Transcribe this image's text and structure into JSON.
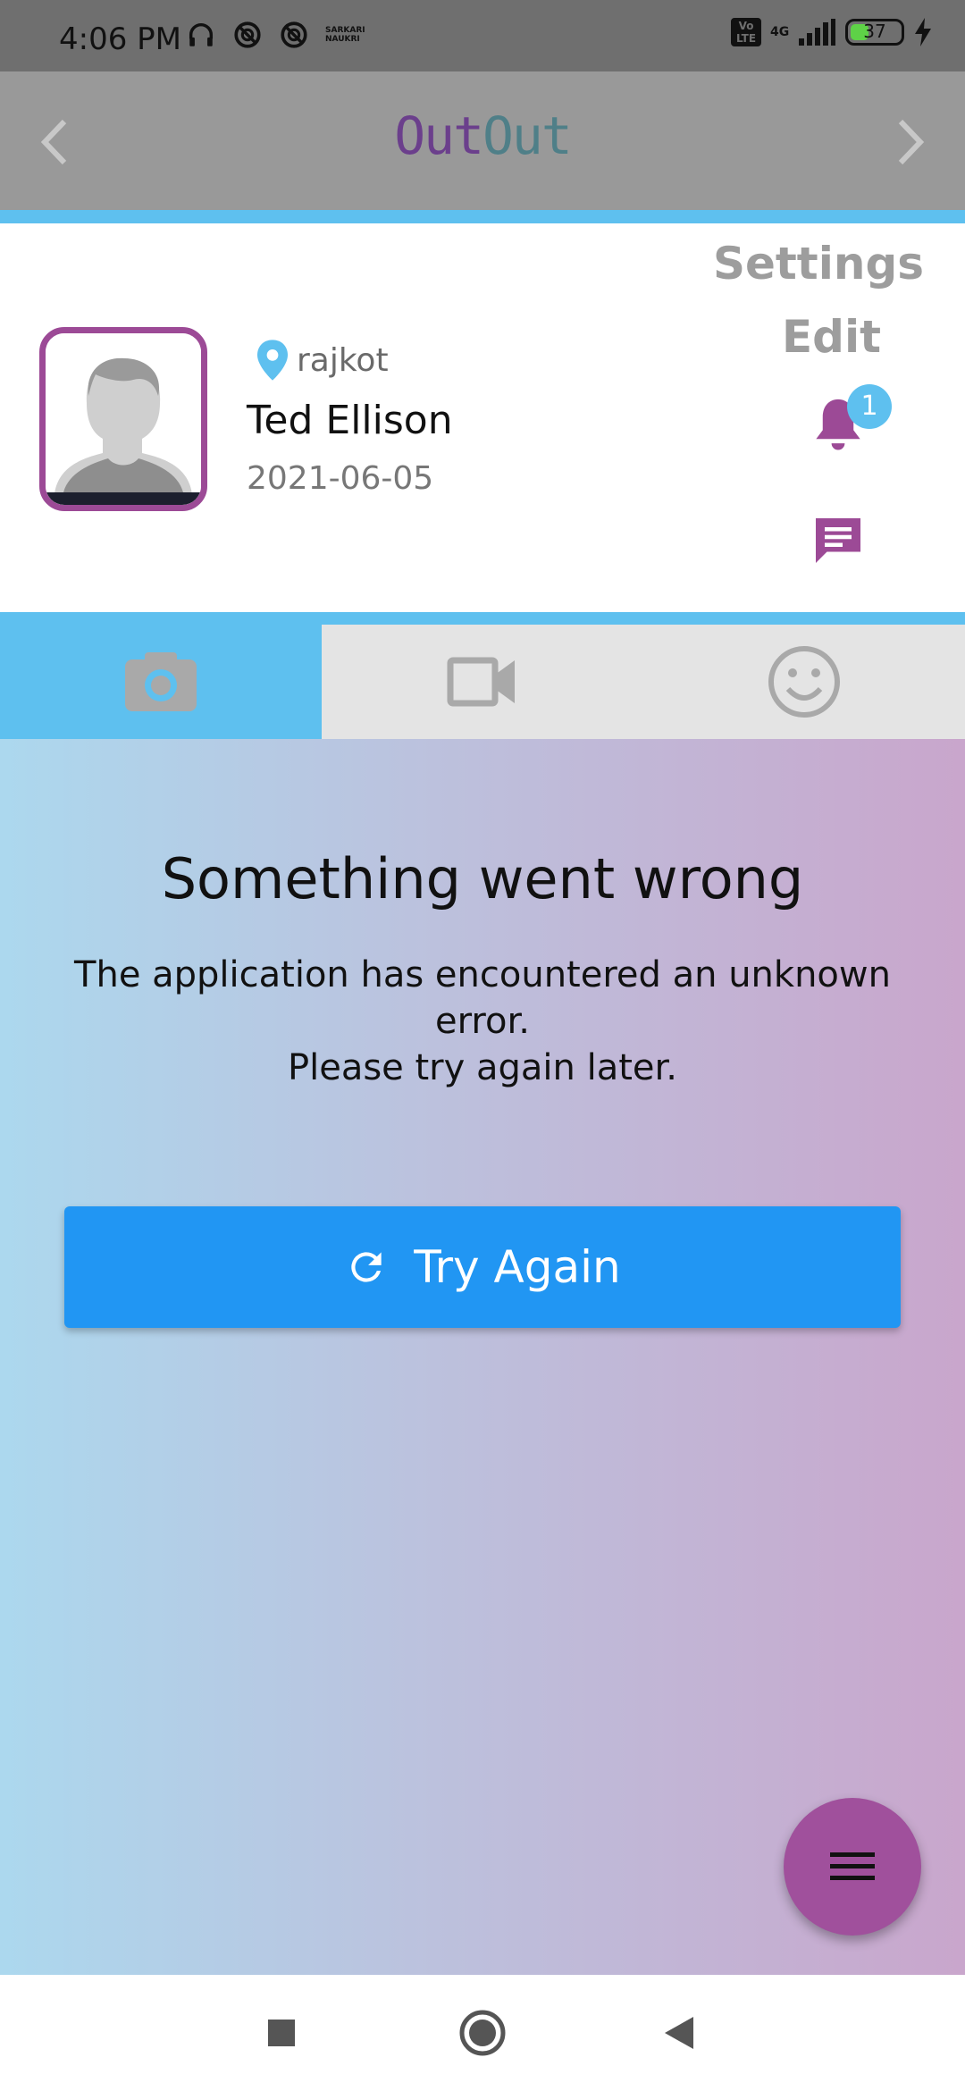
{
  "status_bar": {
    "time": "4:06 PM",
    "sarkari_line1": "SARKARI",
    "sarkari_line2": "NAUKRI",
    "volte": "Vo LTE",
    "network": "4G",
    "battery_percent": "37",
    "battery_level": 0.37,
    "icons": [
      "headset-icon",
      "blocked-icon",
      "blocked-icon",
      "signal-icon",
      "battery-icon",
      "charging-icon"
    ]
  },
  "app_bar": {
    "logo_part1": "Out",
    "logo_part2": "Out",
    "prev_icon": "chevron-left-icon",
    "next_icon": "chevron-right-icon"
  },
  "profile": {
    "location": "rajkot",
    "name": "Ted Ellison",
    "date": "2021-06-05",
    "settings_label": "Settings",
    "edit_label": "Edit",
    "notification_count": "1"
  },
  "tabs": [
    {
      "icon": "camera-icon",
      "active": true
    },
    {
      "icon": "video-icon",
      "active": false
    },
    {
      "icon": "smiley-icon",
      "active": false
    }
  ],
  "error": {
    "title": "Something went wrong",
    "message_line1": "The application has encountered an unknown error.",
    "message_line2": "Please try again later.",
    "button_label": "Try Again"
  },
  "colors": {
    "accent_blue": "#5ec0ef",
    "brand_purple": "#9c4a96",
    "button_blue": "#2196f3",
    "fab_purple": "#a0509c"
  }
}
